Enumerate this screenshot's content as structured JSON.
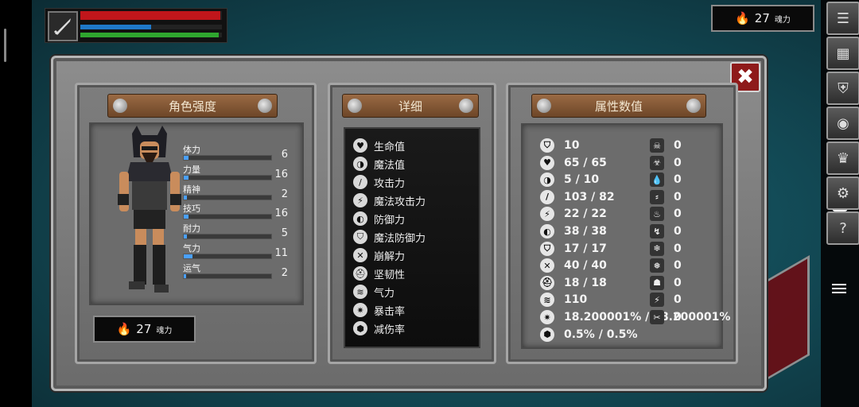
{
  "hud": {
    "weapon_icon": "sword-icon",
    "health_fraction": 0.99,
    "mana_fraction": 0.5,
    "stamina_fraction": 0.98,
    "health_color": "#c0161b",
    "mana_color": "#1f78c8",
    "stamina_color": "#2fa62f"
  },
  "souls_top": {
    "amount": "27",
    "unit": "魂力"
  },
  "side_buttons": [
    "list-icon",
    "backpack-icon",
    "armor-icon",
    "eye-icon",
    "crown-icon",
    "gear-icon",
    "help-icon"
  ],
  "help_glyph": "?",
  "close_glyph": "✖",
  "character": {
    "title": "角色强度",
    "stats": [
      {
        "label": "体力",
        "value": "6",
        "fill": 0.05
      },
      {
        "label": "力量",
        "value": "16",
        "fill": 0.05
      },
      {
        "label": "精神",
        "value": "2",
        "fill": 0.04
      },
      {
        "label": "技巧",
        "value": "16",
        "fill": 0.05
      },
      {
        "label": "耐力",
        "value": "5",
        "fill": 0.04
      },
      {
        "label": "气力",
        "value": "11",
        "fill": 0.1
      },
      {
        "label": "运气",
        "value": "2",
        "fill": 0.03
      }
    ],
    "souls": {
      "amount": "27",
      "unit": "魂力"
    }
  },
  "details": {
    "title": "详细",
    "items": [
      {
        "label": "生命值",
        "icon": "heart-icon"
      },
      {
        "label": "魔法值",
        "icon": "brain-icon"
      },
      {
        "label": "攻击力",
        "icon": "sword-icon"
      },
      {
        "label": "魔法攻击力",
        "icon": "magic-attack-icon"
      },
      {
        "label": "防御力",
        "icon": "shield-icon"
      },
      {
        "label": "魔法防御力",
        "icon": "magic-shield-icon"
      },
      {
        "label": "崩解力",
        "icon": "break-icon"
      },
      {
        "label": "坚韧性",
        "icon": "helmet-icon"
      },
      {
        "label": "气力",
        "icon": "lungs-icon"
      },
      {
        "label": "暴击率",
        "icon": "crit-icon"
      },
      {
        "label": "减伤率",
        "icon": "damage-reduction-icon"
      }
    ]
  },
  "attributes": {
    "title": "属性数值",
    "left": [
      "10",
      "65 / 65",
      "5 / 10",
      "103 / 82",
      "22 / 22",
      "38 / 38",
      "17 / 17",
      "40 / 40",
      "18 / 18",
      "110",
      "18.200001% / 18.200001%",
      "0.5% / 0.5%"
    ],
    "right": [
      "0",
      "0",
      "0",
      "0",
      "0",
      "0",
      "0",
      "0",
      "0",
      "0",
      "0"
    ]
  }
}
